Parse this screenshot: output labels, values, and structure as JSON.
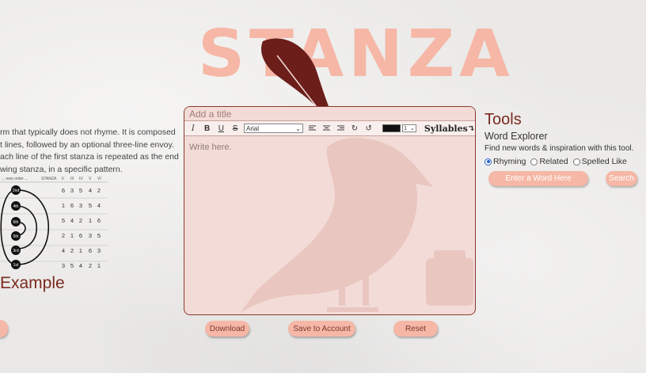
{
  "logo": {
    "text": "STANZA"
  },
  "left": {
    "description_lines": [
      "rm that typically does not rhyme. It is composed",
      "t lines, followed by an optional three-line envoy.",
      "ach line of the first stanza is repeated as the end",
      "wing stanza, in a specific pattern."
    ],
    "table_header": [
      "... new order ...",
      "STANZA",
      "II",
      "III",
      "IV",
      "V",
      "VI"
    ],
    "node_labels": [
      "2nd",
      "4th",
      "6th",
      "5th",
      "3rd",
      "1st"
    ],
    "table_rows": [
      [
        "6",
        "3",
        "5",
        "4",
        "2"
      ],
      [
        "1",
        "6",
        "3",
        "5",
        "4"
      ],
      [
        "5",
        "4",
        "2",
        "1",
        "6"
      ],
      [
        "2",
        "1",
        "6",
        "3",
        "5"
      ],
      [
        "4",
        "2",
        "1",
        "6",
        "3"
      ],
      [
        "3",
        "5",
        "4",
        "2",
        "1"
      ]
    ],
    "example_title": "Example"
  },
  "editor": {
    "title_placeholder": "Add a title",
    "font": "Arial",
    "size": "1",
    "syllables_label": "Syllables",
    "body_placeholder": "Write here.",
    "toolbar_icons": [
      "italic-icon",
      "bold-icon",
      "underline-icon",
      "strikethrough-icon",
      "align-left-icon",
      "align-center-icon",
      "align-right-icon",
      "redo-icon",
      "undo-icon"
    ]
  },
  "actions": {
    "download": "Download",
    "save": "Save to Account",
    "reset": "Reset"
  },
  "tools": {
    "title": "Tools",
    "word_explorer_title": "Word Explorer",
    "word_explorer_desc": "Find new words & inspiration with this tool.",
    "options": [
      "Rhyming",
      "Related",
      "Spelled Like"
    ],
    "selected_option": "Rhyming",
    "input_placeholder": "Enter a Word Here",
    "search_label": "Search"
  },
  "colors": {
    "accent": "#f6b7a6",
    "dark_accent": "#7a2a20",
    "editor_bg": "#f3dcd7"
  }
}
